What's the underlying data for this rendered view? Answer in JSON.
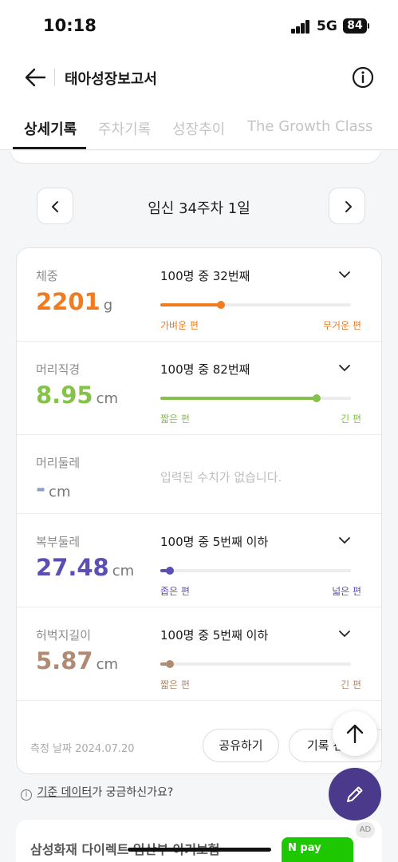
{
  "status_bar": {
    "time": "10:18",
    "network": "5G",
    "battery": "84"
  },
  "header": {
    "title": "태아성장보고서"
  },
  "tabs": [
    "상세기록",
    "주차기록",
    "성장추이",
    "The Growth Class"
  ],
  "date_nav": {
    "label": "임신 34주차 1일"
  },
  "metrics": [
    {
      "label": "체중",
      "value": "2201",
      "unit": "g",
      "rank": "100명 중 32번째",
      "percent": 32,
      "low": "가벼운 편",
      "high": "무거운 편",
      "color": "#f07c1f"
    },
    {
      "label": "머리직경",
      "value": "8.95",
      "unit": "cm",
      "rank": "100명 중 82번째",
      "percent": 82,
      "low": "짧은 편",
      "high": "긴 편",
      "color": "#84c24a"
    },
    {
      "label": "머리둘레",
      "value": "-",
      "unit": "cm",
      "empty_text": "입력된 수치가 없습니다.",
      "color": "#8aa0c9"
    },
    {
      "label": "복부둘레",
      "value": "27.48",
      "unit": "cm",
      "rank": "100명 중 5번째 이하",
      "percent": 5,
      "low": "좁은 편",
      "high": "넓은 편",
      "color": "#5b4fb5"
    },
    {
      "label": "허벅지길이",
      "value": "5.87",
      "unit": "cm",
      "rank": "100명 중 5번째 이하",
      "percent": 5,
      "low": "짧은 편",
      "high": "긴 편",
      "color": "#b08a73"
    }
  ],
  "footer": {
    "measure_date": "측정 날짜 2024.07.20",
    "share": "공유하기",
    "record": "기록 편"
  },
  "help": {
    "info_glyph": "i",
    "link": "기준 데이터",
    "rest": "가 궁금하신가요?"
  },
  "ad": {
    "title": "삼성화재 다이렉트 임산부 아기보험",
    "pay": "N pay",
    "badge": "AD"
  }
}
